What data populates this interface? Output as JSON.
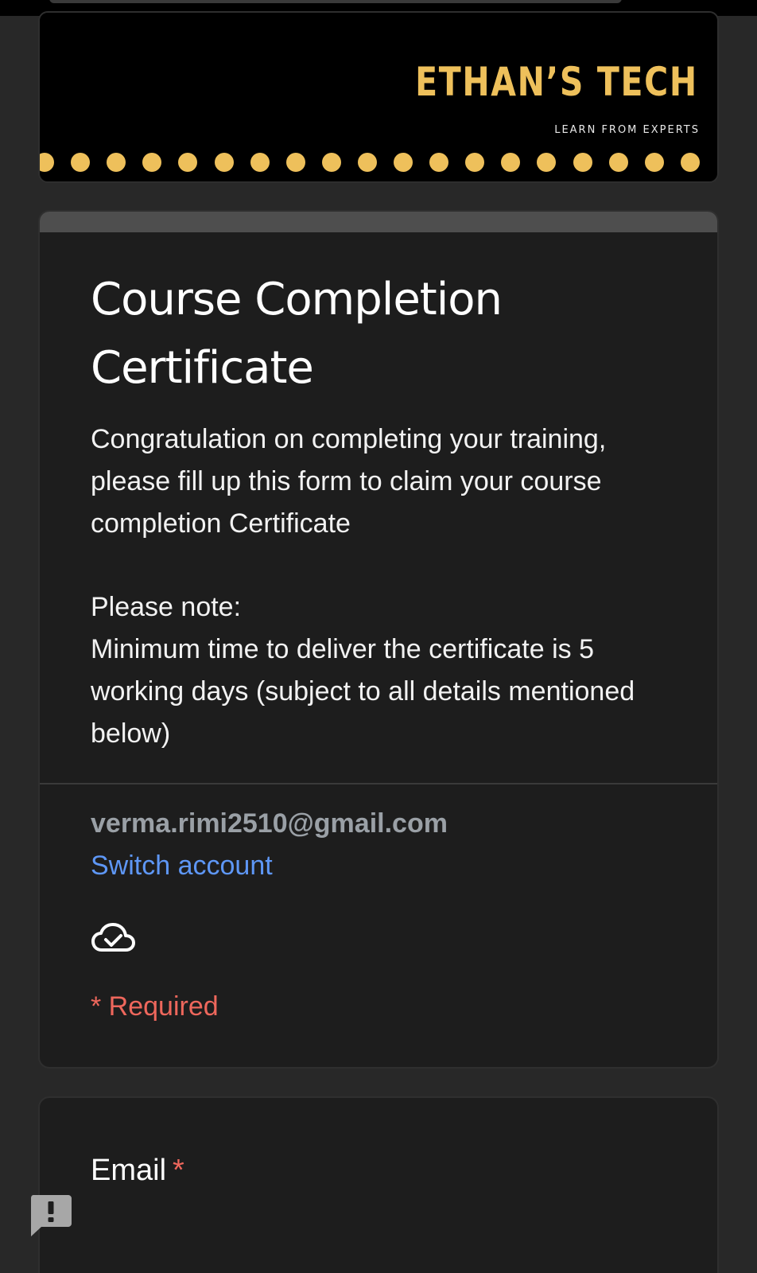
{
  "banner": {
    "title": "ETHAN’S TECH",
    "subtitle": "LEARN FROM EXPERTS",
    "accent_color": "#eec05b"
  },
  "header": {
    "title": "Course Completion Certificate",
    "description": "Congratulation on completing your training, please fill up this form to claim your course completion Certificate\n\nPlease note:\nMinimum time to deliver the certificate is 5 working days (subject to all details mentioned below)",
    "account_email": "verma.rimi2510@gmail.com",
    "switch_account_label": "Switch account",
    "saved_icon": "cloud-check-icon",
    "required_note": "* Required"
  },
  "question": {
    "label": "Email",
    "required_marker": "*"
  },
  "feedback": {
    "icon": "report-feedback-icon"
  },
  "colors": {
    "background": "#282828",
    "card": "#1d1d1d",
    "link": "#5e97f6",
    "required": "#ee675c"
  }
}
